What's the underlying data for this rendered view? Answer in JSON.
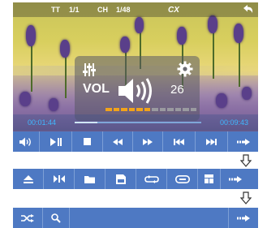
{
  "status": {
    "tt": "TT",
    "tt_val": "1/1",
    "ch": "CH",
    "ch_val": "1/48",
    "format": "CX"
  },
  "volume": {
    "label": "VOL",
    "value": "26",
    "level": 0.5
  },
  "playback": {
    "current": "00:01:44",
    "total": "00:09:43",
    "progress": 0.18
  },
  "colors": {
    "accent": "#4e79c3",
    "time": "#3fb8ff",
    "volume_fill": "#f2a31a"
  },
  "row1_icons": [
    "volume-icon",
    "play-pause-icon",
    "stop-icon",
    "rewind-icon",
    "fast-forward-icon",
    "previous-icon",
    "next-icon",
    "more-arrow-icon"
  ],
  "row2_icons": [
    "eject-icon",
    "aspect-icon",
    "folder-icon",
    "sd-card-icon",
    "repeat-icon",
    "subtitle-icon",
    "windows-icon",
    "more-arrow-icon"
  ],
  "row3_icons": [
    "shuffle-icon",
    "search-icon",
    "more-arrow-icon"
  ]
}
